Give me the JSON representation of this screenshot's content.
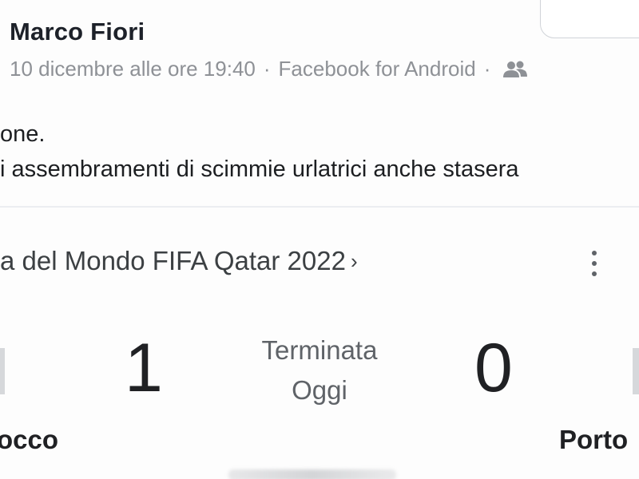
{
  "post": {
    "author": "Marco Fiori",
    "date": "10 dicembre alle ore 19:40",
    "separator": "·",
    "source": "Facebook for Android",
    "audience_icon": "friends-icon",
    "text_lines": [
      "one.",
      "i assembramenti di scimmie urlatrici anche stasera"
    ]
  },
  "match_card": {
    "title": "a del Mondo FIFA Qatar 2022",
    "chevron": "›",
    "home_team": "occo",
    "away_team": "Porto",
    "home_score": "1",
    "away_score": "0",
    "status": "Terminata",
    "when": "Oggi"
  },
  "colors": {
    "author": "#1d2129",
    "meta": "#8e9196",
    "card_title": "#3c4043",
    "score": "#202124",
    "status": "#5f6368"
  }
}
